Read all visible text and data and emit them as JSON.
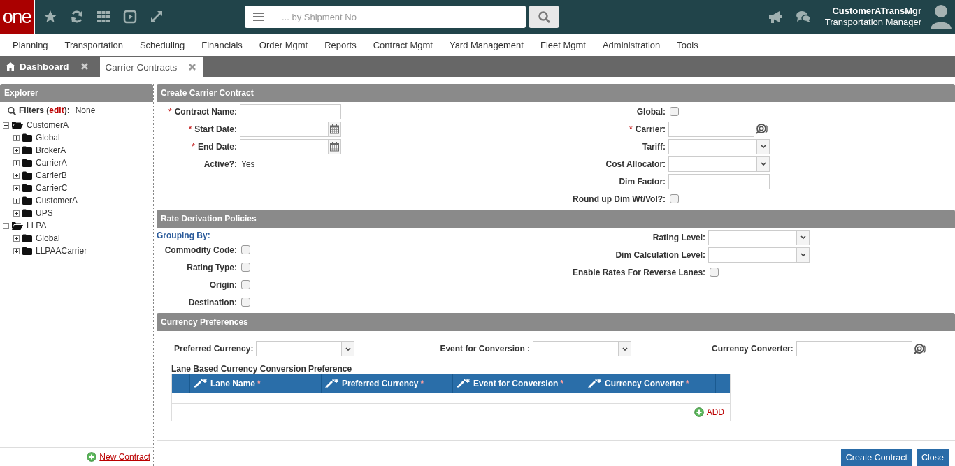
{
  "header": {
    "logo": "one",
    "search_placeholder": "... by Shipment No",
    "user_name": "CustomerATransMgr",
    "user_role": "Transportation Manager"
  },
  "menu": [
    "Planning",
    "Transportation",
    "Scheduling",
    "Financials",
    "Order Mgmt",
    "Reports",
    "Contract Mgmt",
    "Yard Management",
    "Fleet Mgmt",
    "Administration",
    "Tools"
  ],
  "tabs": [
    {
      "label": "Dashboard",
      "kind": "home",
      "selected": false
    },
    {
      "label": "Carrier Contracts",
      "kind": "page",
      "selected": true
    }
  ],
  "explorer": {
    "title": "Explorer",
    "filters": {
      "prefix": "Filters (",
      "link": "edit",
      "suffix": "):",
      "value": "None"
    },
    "tree": [
      {
        "label": "CustomerA",
        "expanded": true,
        "children": [
          {
            "label": "Global",
            "expanded": false
          },
          {
            "label": "BrokerA",
            "expanded": false
          },
          {
            "label": "CarrierA",
            "expanded": false
          },
          {
            "label": "CarrierB",
            "expanded": false
          },
          {
            "label": "CarrierC",
            "expanded": false
          },
          {
            "label": "CustomerA",
            "expanded": false
          },
          {
            "label": "UPS",
            "expanded": false
          }
        ]
      },
      {
        "label": "LLPA",
        "expanded": true,
        "children": [
          {
            "label": "Global",
            "expanded": false
          },
          {
            "label": "LLPAACarrier",
            "expanded": false
          }
        ]
      }
    ],
    "new_link": "New Contract"
  },
  "sections": [
    {
      "title": "Create Carrier Contract",
      "left": [
        {
          "label": "Contract Name:",
          "kind": "text",
          "required_mark": "*"
        },
        {
          "label": "Start Date:",
          "kind": "date",
          "required_mark": "*"
        },
        {
          "label": "End Date:",
          "kind": "date",
          "required_mark": "*"
        },
        {
          "label": "Active?:",
          "kind": "static",
          "value": "Yes"
        }
      ],
      "right": [
        {
          "label": "Global:",
          "kind": "checkbox",
          "checked": false
        },
        {
          "label": "Carrier:",
          "kind": "lookup",
          "required_mark": "*"
        },
        {
          "label": "Tariff:",
          "kind": "select"
        },
        {
          "label": "Cost Allocator:",
          "kind": "select"
        },
        {
          "label": "Dim Factor:",
          "kind": "text"
        },
        {
          "label": "Round up Dim Wt/Vol?:",
          "kind": "checkbox",
          "checked": false
        }
      ]
    },
    {
      "title": "Rate Derivation Policies",
      "group_heading": "Grouping By:",
      "left": [
        {
          "label": "Commodity Code:",
          "kind": "checkbox",
          "checked": false
        },
        {
          "label": "Rating Type:",
          "kind": "checkbox",
          "checked": false
        },
        {
          "label": "Origin:",
          "kind": "checkbox",
          "checked": false
        },
        {
          "label": "Destination:",
          "kind": "checkbox",
          "checked": false
        }
      ],
      "right": [
        {
          "label": "Rating Level:",
          "kind": "select"
        },
        {
          "label": "Dim Calculation Level:",
          "kind": "select"
        },
        {
          "label": "Enable Rates For Reverse Lanes:",
          "kind": "checkbox",
          "checked": false
        }
      ]
    }
  ],
  "currency": {
    "title": "Currency Preferences",
    "fields": [
      {
        "label": "Preferred Currency:",
        "kind": "select"
      },
      {
        "label": "Event for Conversion :",
        "kind": "select"
      },
      {
        "label": "Currency Converter:",
        "kind": "lookup"
      }
    ],
    "table_title": "Lane Based Currency Conversion Preference",
    "columns": [
      {
        "label": "Lane Name",
        "required_mark": "*"
      },
      {
        "label": "Preferred Currency",
        "required_mark": "*"
      },
      {
        "label": "Event for Conversion",
        "required_mark": "*"
      },
      {
        "label": "Currency Converter",
        "required_mark": "*"
      }
    ],
    "add_label": "ADD"
  },
  "footer_buttons": [
    {
      "label": "Create Contract"
    },
    {
      "label": "Close"
    }
  ]
}
